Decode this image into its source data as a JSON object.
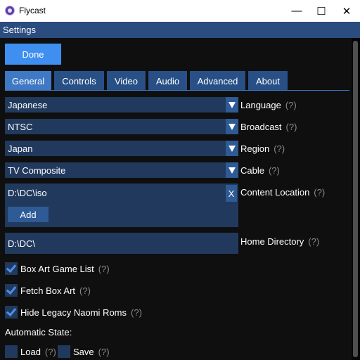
{
  "window": {
    "title": "Flycast",
    "controls": {
      "minimize": "—",
      "maximize": "☐",
      "close": "✕"
    }
  },
  "header": {
    "title": "Settings"
  },
  "done_label": "Done",
  "tabs": [
    {
      "label": "General",
      "active": true
    },
    {
      "label": "Controls",
      "active": false
    },
    {
      "label": "Video",
      "active": false
    },
    {
      "label": "Audio",
      "active": false
    },
    {
      "label": "Advanced",
      "active": false
    },
    {
      "label": "About",
      "active": false
    }
  ],
  "settings": {
    "language": {
      "value": "Japanese",
      "label": "Language",
      "help": "(?)"
    },
    "broadcast": {
      "value": "NTSC",
      "label": "Broadcast",
      "help": "(?)"
    },
    "region": {
      "value": "Japan",
      "label": "Region",
      "help": "(?)"
    },
    "cable": {
      "value": "TV Composite",
      "label": "Cable",
      "help": "(?)"
    },
    "content_location": {
      "path": "D:\\DC\\iso",
      "remove": "X",
      "add": "Add",
      "label": "Content Location",
      "help": "(?)"
    },
    "home_directory": {
      "value": "D:\\DC\\",
      "label": "Home Directory",
      "help": "(?)"
    }
  },
  "checkboxes": {
    "box_art_game_list": {
      "label": "Box Art Game List",
      "help": "(?)",
      "checked": true
    },
    "fetch_box_art": {
      "label": "Fetch Box Art",
      "help": "(?)",
      "checked": true
    },
    "hide_legacy_naomi_roms": {
      "label": "Hide Legacy Naomi Roms",
      "help": "(?)",
      "checked": true
    }
  },
  "automatic_state": {
    "title": "Automatic State:",
    "load": {
      "label": "Load",
      "help": "(?)",
      "checked": false
    },
    "save": {
      "label": "Save",
      "help": "(?)",
      "checked": false
    }
  },
  "colors": {
    "accent": "#3f8ff0",
    "tab": "#285086",
    "tab_active": "#3f78c4",
    "field": "#21395d",
    "header": "#2a4c7f",
    "background": "#0f0f0f"
  }
}
